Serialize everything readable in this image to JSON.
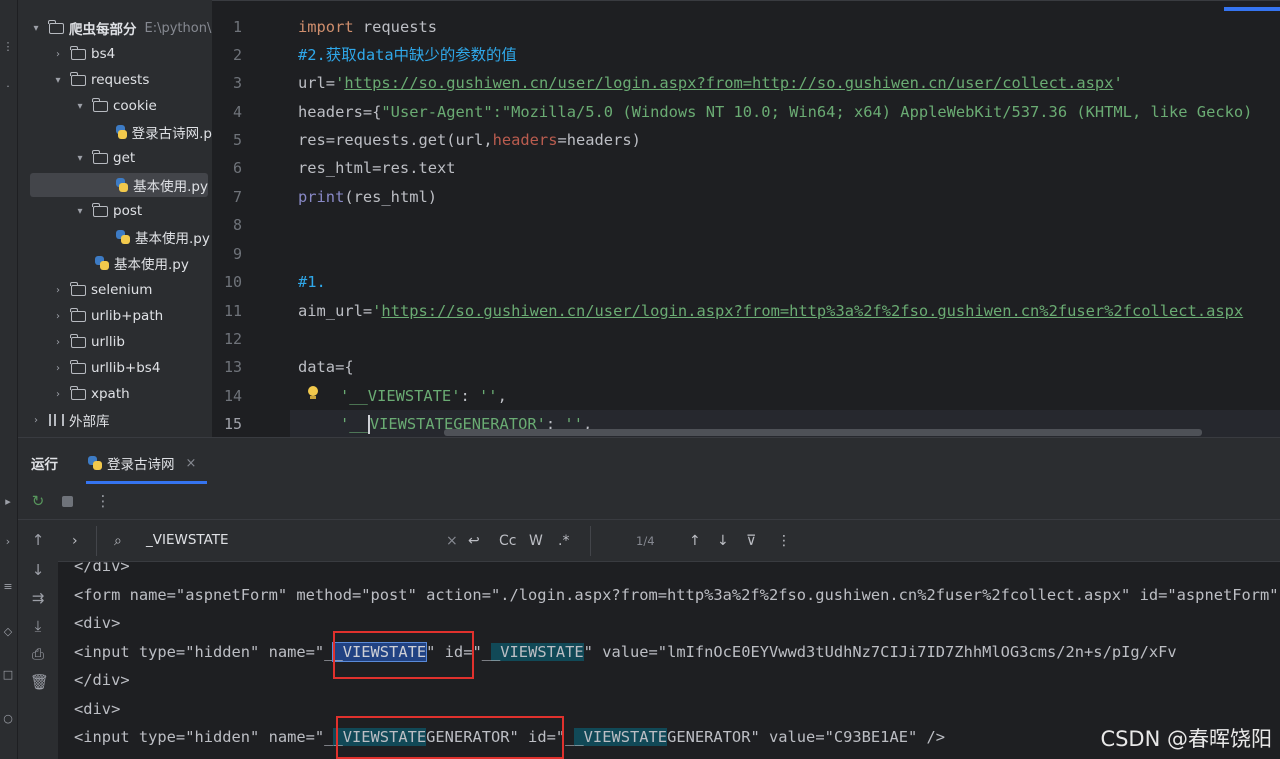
{
  "project_tree": {
    "root_label": "爬虫每部分",
    "root_path": "E:\\python\\",
    "items": [
      {
        "label": "bs4"
      },
      {
        "label": "requests"
      },
      {
        "label": "cookie"
      },
      {
        "label": "登录古诗网.p"
      },
      {
        "label": "get"
      },
      {
        "label": "基本使用.py"
      },
      {
        "label": "post"
      },
      {
        "label": "基本使用.py"
      },
      {
        "label": "基本使用.py"
      },
      {
        "label": "selenium"
      },
      {
        "label": "urlib+path"
      },
      {
        "label": "urllib"
      },
      {
        "label": "urllib+bs4"
      },
      {
        "label": "xpath"
      },
      {
        "label": "外部库"
      }
    ]
  },
  "editor": {
    "line_numbers": [
      "1",
      "2",
      "3",
      "4",
      "5",
      "6",
      "7",
      "8",
      "9",
      "10",
      "11",
      "12",
      "13",
      "14",
      "15"
    ],
    "lines": {
      "l1_kw": "import",
      "l1_rest": " requests",
      "l2": "#2.获取data中缺少的参数的值",
      "l3_a": "url=",
      "l3_q1": "'",
      "l3_url": "https://so.gushiwen.cn/user/login.aspx?from=http://so.gushiwen.cn/user/collect.aspx",
      "l3_q2": "'",
      "l4_a": "headers={",
      "l4_str": "\"User-Agent\":\"Mozilla/5.0 (Windows NT 10.0; Win64; x64) AppleWebKit/537.36 (KHTML, like Gecko)",
      "l5_a": "res=requests.get(url,",
      "l5_param": "headers",
      "l5_b": "=headers)",
      "l6": "res_html=res.text",
      "l7_fn": "print",
      "l7_rest": "(res_html)",
      "l10": "#1.",
      "l11_a": "aim_url=",
      "l11_q": "'",
      "l11_url": "https://so.gushiwen.cn/user/login.aspx?from=http%3a%2f%2fso.gushiwen.cn%2fuser%2fcollect.aspx",
      "l13": "data={",
      "l14_str": "'__VIEWSTATE'",
      "l14_b": ": ",
      "l14_c": "''",
      "l14_d": ",",
      "l15_str1": "'__",
      "l15_str2": "VIEWSTATEGENERATOR'",
      "l15_b": ": ",
      "l15_c": "''",
      "l15_d": ","
    }
  },
  "run_panel": {
    "title": "运行",
    "tab_label": "登录古诗网",
    "tab_close": "×",
    "search_query": "_VIEWSTATE",
    "match_count": "1/4",
    "options": {
      "case": "Cc",
      "word": "W",
      "regex": ".*"
    },
    "console_lines": {
      "o0": "</div>",
      "o1": "<form name=\"aspnetForm\" method=\"post\" action=\"./login.aspx?from=http%3a%2f%2fso.gushiwen.cn%2fuser%2fcollect.aspx\" id=\"aspnetForm\"",
      "o2": "<div>",
      "o3_a": "<input type=\"hidden\" name=\"_",
      "o3_h1": "_VIEWSTATE",
      "o3_b": "\" id=\"_",
      "o3_h2": "_VIEWSTATE",
      "o3_c": "\" value=\"lmIfnOcE0EYVwwd3tUdhNz7CIJi7ID7ZhhMlOG3cms/2n+s/pIg/xFv",
      "o4": "</div>",
      "o5": "<div>",
      "o6_a": "<input type=\"hidden\" name=\"_",
      "o6_h1": "_VIEWSTATE",
      "o6_b": "GENERATOR\" id=\"_",
      "o6_h2": "_VIEWSTATE",
      "o6_c": "GENERATOR\" value=\"C93BE1AE\" />"
    }
  },
  "watermark": "CSDN @春晖饶阳",
  "colors": {
    "accent": "#3574f0",
    "highlight": "#114957",
    "annotation_red": "#e0312d"
  }
}
